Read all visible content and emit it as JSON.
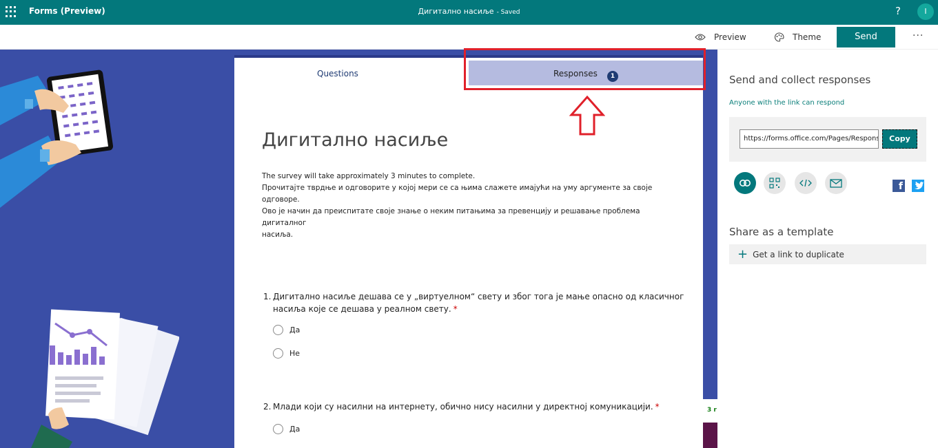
{
  "topbar": {
    "app_title": "Forms (Preview)",
    "doc_title": "Дигитално насиље",
    "status": "- Saved",
    "help": "?",
    "avatar_initial": "I"
  },
  "commandbar": {
    "preview": "Preview",
    "theme": "Theme",
    "send": "Send",
    "more": "···"
  },
  "tabs": {
    "questions": "Questions",
    "responses": "Responses",
    "responses_count": "1"
  },
  "form": {
    "title": "Дигитално насиље",
    "description": [
      "The survey will take approximately 3 minutes to complete.",
      "Прочитајте тврдње и одговорите у којој мери се са њима слажете имајући на уму аргументе за своје",
      "одговоре.",
      "Ово је начин да преиспитате своје знање о неким питањима за превенцију и решавање проблема",
      "дигиталног",
      "насиља."
    ],
    "questions": [
      {
        "number": "1.",
        "lines": [
          "Дигитално насиље дешава се у „виртуелном“ свету и због тога је мање опасно од класичног",
          "насиља које се дешава у реалном свету."
        ],
        "required": "*",
        "options": [
          "Да",
          "Не"
        ]
      },
      {
        "number": "2.",
        "lines": [
          "Млади који су насилни на интернету, обично нису насилни у директној комуникацији."
        ],
        "required": "*",
        "options": [
          "Да"
        ]
      }
    ]
  },
  "right_pane": {
    "send_heading": "Send and collect responses",
    "link_permission": "Anyone with the link can respond",
    "link_url": "https://forms.office.com/Pages/ResponsePage.aspx",
    "copy": "Copy",
    "share_icons": [
      "link-icon",
      "qr-code-icon",
      "embed-icon",
      "email-icon"
    ],
    "social": [
      "facebook-icon",
      "twitter-icon"
    ],
    "template_heading": "Share as a template",
    "template_action": "Get a link to duplicate"
  },
  "peek_text": "3 r",
  "colors": {
    "brand": "#03787c",
    "background": "#3a4ea6",
    "responses_tab": "#b5bbe0",
    "annotation": "#e0202a"
  }
}
